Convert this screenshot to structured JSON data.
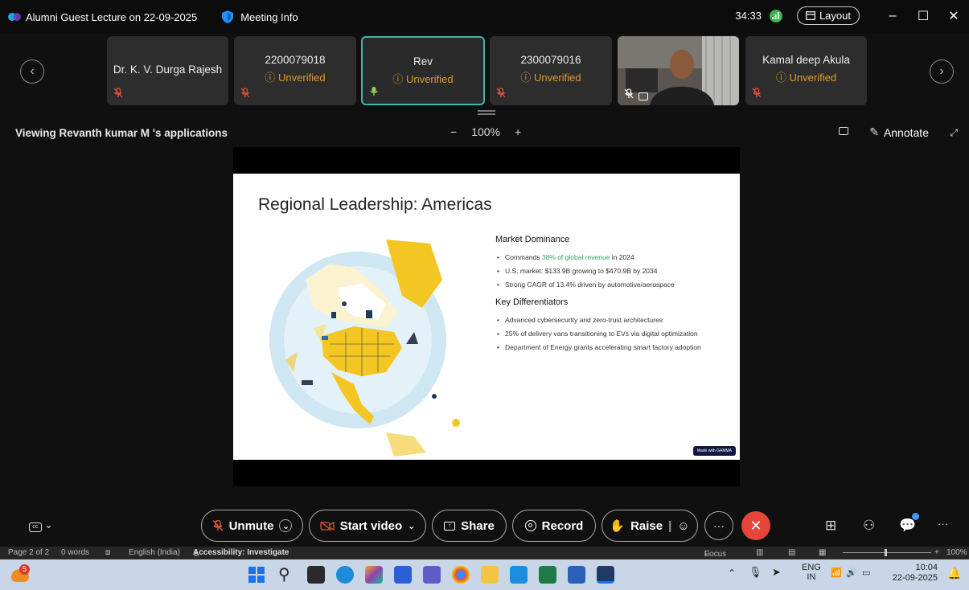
{
  "titlebar": {
    "meeting_title": "Alumni Guest Lecture on 22-09-2025",
    "meeting_info": "Meeting Info",
    "timer": "34:33",
    "layout_label": "Layout"
  },
  "participants": [
    {
      "name": "Dr. K. V. Durga Rajesh",
      "status": ""
    },
    {
      "name": "2200079018",
      "status": "Unverified"
    },
    {
      "name": "Rev",
      "status": "Unverified"
    },
    {
      "name": "2300079016",
      "status": "Unverified"
    },
    {
      "name": "",
      "status": ""
    },
    {
      "name": "Kamal deep Akula",
      "status": "Unverified"
    }
  ],
  "share": {
    "viewing_label": "Viewing Revanth kumar M 's applications",
    "zoom": "100%",
    "annotate": "Annotate"
  },
  "slide": {
    "title": "Regional Leadership: Americas",
    "section1": "Market Dominance",
    "b1_pre": "Commands ",
    "b1_hl": "38% of global revenue",
    "b1_post": " in 2024",
    "b2": "U.S. market: $133.9B growing to $470.9B by 2034",
    "b3": "Strong CAGR of 13.4% driven by automotive/aerospace",
    "section2": "Key Differentiators",
    "b4": "Advanced cybersecurity and zero-trust architectures",
    "b5": "25% of delivery vans transitioning to EVs via digital optimization",
    "b6": "Department of Energy grants accelerating smart factory adoption",
    "badge": "Made with GAMMA"
  },
  "controls": {
    "unmute": "Unmute",
    "start_video": "Start video",
    "share": "Share",
    "record": "Record",
    "raise": "Raise"
  },
  "statusbar": {
    "page": "Page 2 of 2",
    "words": "0 words",
    "language": "English (India)",
    "accessibility": "Accessibility: Investigate",
    "focus": "Focus",
    "zoom": "100%"
  },
  "taskbar": {
    "notif_count": "5",
    "lang": "ENG",
    "region": "IN",
    "time": "10:04",
    "date": "22-09-2025"
  },
  "colors": {
    "accent": "#3fb7a8",
    "unverified": "#e39a2e",
    "end_call": "#e6453c",
    "map_yellow": "#f3c623"
  }
}
